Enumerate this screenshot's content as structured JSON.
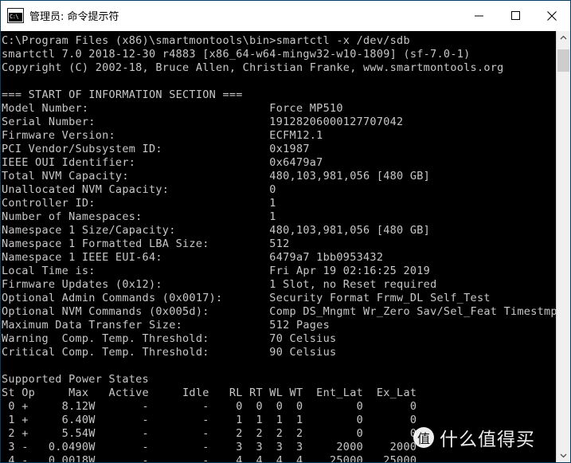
{
  "window": {
    "title": "管理员: 命令提示符",
    "icon": "cmd-console-icon",
    "controls": {
      "minimize": "—",
      "maximize": "□",
      "close": "✕"
    },
    "colors": {
      "titlebar_bg": "#ffffff",
      "console_bg": "#000000",
      "console_fg": "#c8c8c8",
      "border": "#0a3d62",
      "scrollbar_track": "#f0f0f0",
      "scrollbar_thumb": "#cdcdcd"
    }
  },
  "scrollbar": {
    "up_arrow": "⌃",
    "down_arrow": "⌄"
  },
  "console": {
    "prompt_line": "C:\\Program Files (x86)\\smartmontools\\bin>smartctl -x /dev/sdb",
    "version_line": "smartctl 7.0 2018-12-30 r4883 [x86_64-w64-mingw32-w10-1809] (sf-7.0-1)",
    "copyright_line": "Copyright (C) 2002-18, Bruce Allen, Christian Franke, www.smartmontools.org",
    "section_header": "=== START OF INFORMATION SECTION ===",
    "info_fields": [
      {
        "label": "Model Number:",
        "value": "Force MP510"
      },
      {
        "label": "Serial Number:",
        "value": "19128206000127707042"
      },
      {
        "label": "Firmware Version:",
        "value": "ECFM12.1"
      },
      {
        "label": "PCI Vendor/Subsystem ID:",
        "value": "0x1987"
      },
      {
        "label": "IEEE OUI Identifier:",
        "value": "0x6479a7"
      },
      {
        "label": "Total NVM Capacity:",
        "value": "480,103,981,056 [480 GB]"
      },
      {
        "label": "Unallocated NVM Capacity:",
        "value": "0"
      },
      {
        "label": "Controller ID:",
        "value": "1"
      },
      {
        "label": "Number of Namespaces:",
        "value": "1"
      },
      {
        "label": "Namespace 1 Size/Capacity:",
        "value": "480,103,981,056 [480 GB]"
      },
      {
        "label": "Namespace 1 Formatted LBA Size:",
        "value": "512"
      },
      {
        "label": "Namespace 1 IEEE EUI-64:",
        "value": "6479a7 1bb0953432"
      },
      {
        "label": "Local Time is:",
        "value": "Fri Apr 19 02:16:25 2019"
      },
      {
        "label": "Firmware Updates (0x12):",
        "value": "1 Slot, no Reset required"
      },
      {
        "label": "Optional Admin Commands (0x0017):",
        "value": "Security Format Frmw_DL Self_Test"
      },
      {
        "label": "Optional NVM Commands (0x005d):",
        "value": "Comp DS_Mngmt Wr_Zero Sav/Sel_Feat Timestmp"
      },
      {
        "label": "Maximum Data Transfer Size:",
        "value": "512 Pages"
      },
      {
        "label": "Warning  Comp. Temp. Threshold:",
        "value": "70 Celsius"
      },
      {
        "label": "Critical Comp. Temp. Threshold:",
        "value": "90 Celsius"
      }
    ],
    "power_states": {
      "title": "Supported Power States",
      "header": "St Op     Max   Active     Idle   RL RT WL WT  Ent_Lat  Ex_Lat",
      "rows": [
        " 0 +     8.12W       -        -    0  0  0  0        0       0",
        " 1 +     6.40W       -        -    1  1  1  1        0       0",
        " 2 +     5.54W       -        -    2  2  2  2        0       0",
        " 3 -   0.0490W       -        -    3  3  3  3     2000    2000",
        " 4 -   0.0018W       -        -    4  4  4  4    25000   25000"
      ],
      "columns": [
        "St",
        "Op",
        "Max",
        "Active",
        "Idle",
        "RL",
        "RT",
        "WL",
        "WT",
        "Ent_Lat",
        "Ex_Lat"
      ],
      "data": [
        {
          "St": "0",
          "Op": "+",
          "Max": "8.12W",
          "Active": "-",
          "Idle": "-",
          "RL": "0",
          "RT": "0",
          "WL": "0",
          "WT": "0",
          "Ent_Lat": "0",
          "Ex_Lat": "0"
        },
        {
          "St": "1",
          "Op": "+",
          "Max": "6.40W",
          "Active": "-",
          "Idle": "-",
          "RL": "1",
          "RT": "1",
          "WL": "1",
          "WT": "1",
          "Ent_Lat": "0",
          "Ex_Lat": "0"
        },
        {
          "St": "2",
          "Op": "+",
          "Max": "5.54W",
          "Active": "-",
          "Idle": "-",
          "RL": "2",
          "RT": "2",
          "WL": "2",
          "WT": "2",
          "Ent_Lat": "0",
          "Ex_Lat": "0"
        },
        {
          "St": "3",
          "Op": "-",
          "Max": "0.0490W",
          "Active": "-",
          "Idle": "-",
          "RL": "3",
          "RT": "3",
          "WL": "3",
          "WT": "3",
          "Ent_Lat": "2000",
          "Ex_Lat": "2000"
        },
        {
          "St": "4",
          "Op": "-",
          "Max": "0.0018W",
          "Active": "-",
          "Idle": "-",
          "RL": "4",
          "RT": "4",
          "WL": "4",
          "WT": "4",
          "Ent_Lat": "25000",
          "Ex_Lat": "25000"
        }
      ]
    }
  },
  "watermark": {
    "badge": "值",
    "text": "什么值得买"
  }
}
